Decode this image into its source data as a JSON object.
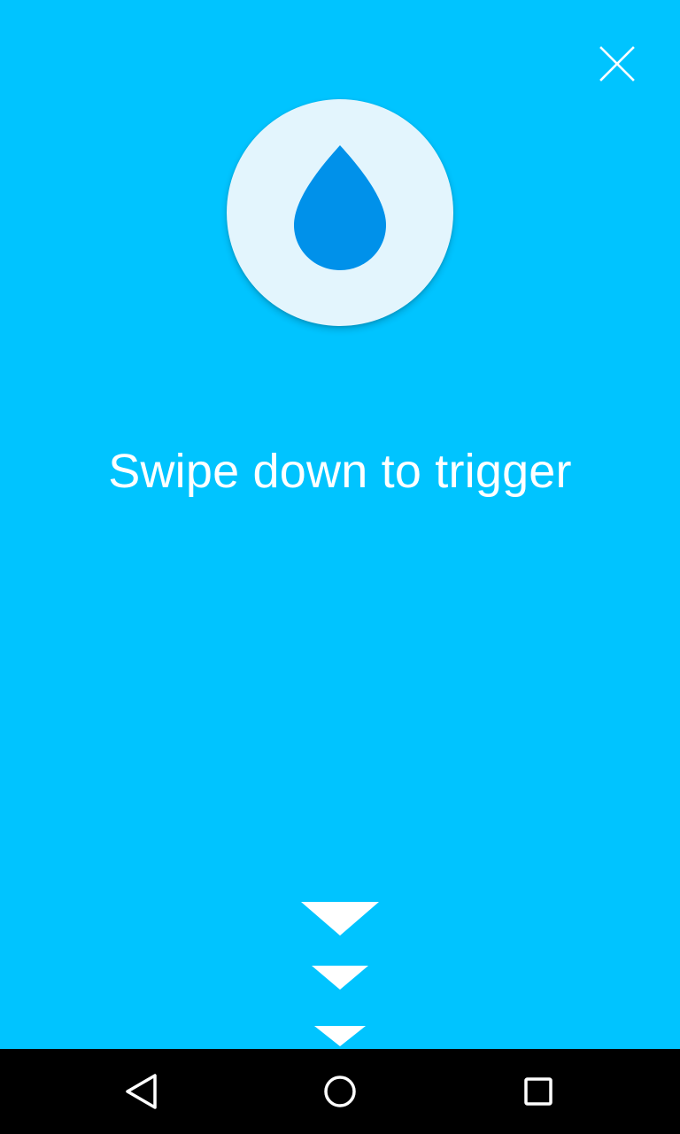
{
  "screen": {
    "background_color": "#00c4ff",
    "instruction_text": "Swipe down to trigger",
    "text_color": "#ffffff"
  },
  "close_button": {
    "icon": "close-icon"
  },
  "hero": {
    "icon": "water-drop-icon",
    "circle_color": "#e3f5fd",
    "drop_color": "#0091ea"
  },
  "swipe_indicator": {
    "icon": "chevron-down-icon",
    "count": 3
  },
  "navigation_bar": {
    "background_color": "#000000",
    "buttons": [
      {
        "icon": "back-icon"
      },
      {
        "icon": "home-icon"
      },
      {
        "icon": "recents-icon"
      }
    ]
  }
}
